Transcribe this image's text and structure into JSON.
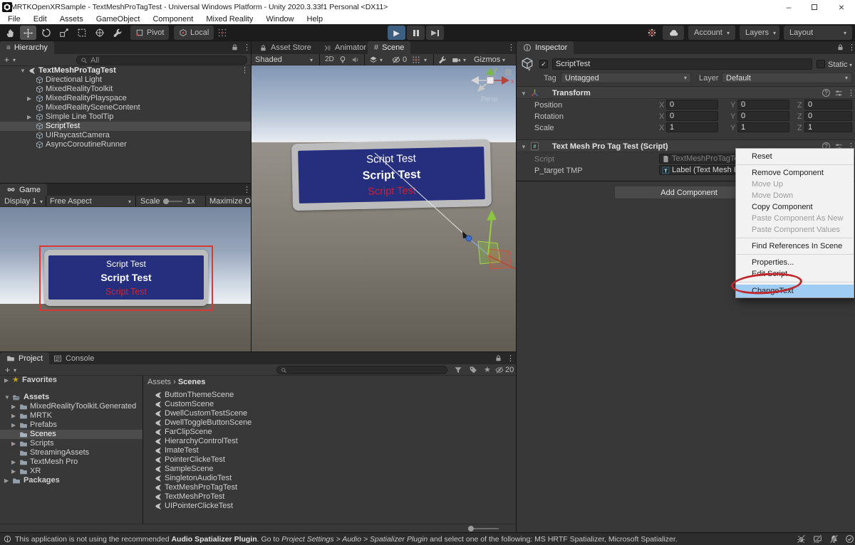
{
  "colors": {
    "menu_highlight": "#9fccf3",
    "annotation_red": "#c1272d",
    "tooltip_panel_blue": "#252f7d",
    "tooltip_text_red": "#d2232e",
    "selection_row_gray": "#4c4c4c",
    "play_active_blue": "#3d5f81"
  },
  "icons": {
    "kebab": "⋮",
    "dropdown": "▾",
    "foldout_open": "▼",
    "foldout_closed": "▶",
    "star": "★",
    "plus": "+",
    "breadcrumb_sep": "›",
    "hash": "#",
    "check": "✓",
    "play": "▶",
    "minimize": "–",
    "close": "×"
  },
  "title_bar": {
    "title": "MRTKOpenXRSample - TextMeshProTagTest - Universal Windows Platform - Unity 2020.3.33f1 Personal <DX11>"
  },
  "menu_bar": {
    "items": [
      "File",
      "Edit",
      "Assets",
      "GameObject",
      "Component",
      "Mixed Reality",
      "Window",
      "Help"
    ]
  },
  "toolbar": {
    "pivot": "Pivot",
    "local": "Local",
    "account": "Account",
    "layers": "Layers",
    "layout": "Layout"
  },
  "hierarchy": {
    "tab": "Hierarchy",
    "search_scope": "All",
    "root": "TextMeshProTagTest",
    "items": [
      {
        "label": "Directional Light"
      },
      {
        "label": "MixedRealityToolkit"
      },
      {
        "label": "MixedRealityPlayspace"
      },
      {
        "label": "MixedRealitySceneContent"
      },
      {
        "label": "Simple Line ToolTip"
      },
      {
        "label": "ScriptTest"
      },
      {
        "label": "UIRaycastCamera"
      },
      {
        "label": "AsyncCoroutineRunner"
      }
    ]
  },
  "game": {
    "tab": "Game",
    "display": "Display 1",
    "aspect": "Free Aspect",
    "scale_label": "Scale",
    "scale_value": "1x",
    "maximize_label": "Maximize On Play",
    "tooltip": {
      "line1": "Script Test",
      "line2": "Script Test",
      "line3": "Script Test"
    }
  },
  "scene": {
    "tabs": {
      "asset_store": "Asset Store",
      "animator": "Animator",
      "scene": "Scene"
    },
    "draw_mode": "Shaded",
    "mode_2d": "2D",
    "hidden_count": "0",
    "gizmos_label": "Gizmos",
    "axis_x": "x",
    "axis_y": "y",
    "persp": "Persp",
    "tooltip": {
      "line1": "Script Test",
      "line2": "Script Test",
      "line3": "Script Test"
    }
  },
  "inspector": {
    "tab": "Inspector",
    "name": "ScriptTest",
    "static_label": "Static",
    "tag_label": "Tag",
    "tag_value": "Untagged",
    "layer_label": "Layer",
    "layer_value": "Default",
    "transform": {
      "title": "Transform",
      "axis_x": "X",
      "axis_y": "Y",
      "axis_z": "Z",
      "rows": [
        {
          "label": "Position",
          "x": "0",
          "y": "0",
          "z": "0"
        },
        {
          "label": "Rotation",
          "x": "0",
          "y": "0",
          "z": "0"
        },
        {
          "label": "Scale",
          "x": "1",
          "y": "1",
          "z": "1"
        }
      ]
    },
    "script_component": {
      "title": "Text Mesh Pro Tag Test (Script)",
      "script_label": "Script",
      "script_value": "TextMeshProTagTes",
      "target_label": "P_target TMP",
      "target_value": "Label (Text Mesh Pro"
    },
    "add_component": "Add Component"
  },
  "context_menu": {
    "items": [
      {
        "label": "Reset",
        "enabled": true
      },
      {
        "label": "Remove Component",
        "enabled": true
      },
      {
        "label": "Move Up",
        "enabled": false
      },
      {
        "label": "Move Down",
        "enabled": false
      },
      {
        "label": "Copy Component",
        "enabled": true
      },
      {
        "label": "Paste Component As New",
        "enabled": false
      },
      {
        "label": "Paste Component Values",
        "enabled": false
      },
      {
        "label": "Find References In Scene",
        "enabled": true
      },
      {
        "label": "Properties...",
        "enabled": true
      },
      {
        "label": "Edit Script",
        "enabled": true
      },
      {
        "label": "ChangeText",
        "enabled": true,
        "highlighted": true
      }
    ]
  },
  "project": {
    "tab": "Project",
    "console_tab": "Console",
    "favorites": "Favorites",
    "assets_root": "Assets",
    "packages_root": "Packages",
    "folders": [
      {
        "label": "MixedRealityToolkit.Generated"
      },
      {
        "label": "MRTK"
      },
      {
        "label": "Prefabs"
      },
      {
        "label": "Scenes"
      },
      {
        "label": "Scripts"
      },
      {
        "label": "StreamingAssets"
      },
      {
        "label": "TextMesh Pro"
      },
      {
        "label": "XR"
      }
    ],
    "breadcrumb": {
      "root": "Assets",
      "current": "Scenes"
    },
    "scenes": [
      "ButtonThemeScene",
      "CustomScene",
      "DwellCustomTestScene",
      "DwellToggleButtonScene",
      "FarClipScene",
      "HierarchyControlTest",
      "ImateTest",
      "PointerClickeTest",
      "SampleScene",
      "SingletonAudioTest",
      "TextMeshProTagTest",
      "TextMeshProTest",
      "UIPointerClickeTest"
    ],
    "hidden_count": "20"
  },
  "status_bar": {
    "seg1": "This application is not using the recommended ",
    "seg2": "Audio Spatializer Plugin",
    "seg3": ". Go to ",
    "seg4": "Project Settings > Audio > Spatializer Plugin",
    "seg5": " and select one of the following: MS HRTF Spatializer, Microsoft Spatializer."
  }
}
